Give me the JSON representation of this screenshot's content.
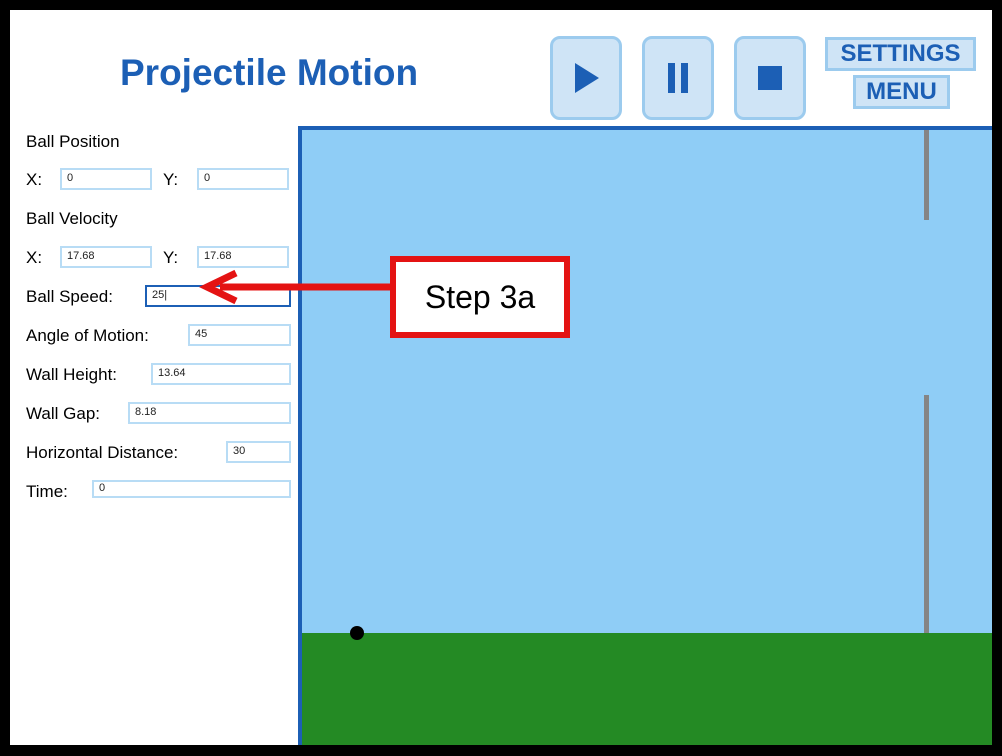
{
  "title": "Projectile Motion",
  "controls": {
    "play": "play-icon",
    "pause": "pause-icon",
    "stop": "stop-icon",
    "settings_label": "SETTINGS",
    "menu_label": "MENU"
  },
  "panel": {
    "ball_position_label": "Ball Position",
    "pos_x_label": "X:",
    "pos_x_value": "0",
    "pos_y_label": "Y:",
    "pos_y_value": "0",
    "ball_velocity_label": "Ball Velocity",
    "vel_x_label": "X:",
    "vel_x_value": "17.68",
    "vel_y_label": "Y:",
    "vel_y_value": "17.68",
    "speed_label": "Ball Speed:",
    "speed_value": "25|",
    "angle_label": "Angle of Motion:",
    "angle_value": "45",
    "wall_height_label": "Wall Height:",
    "wall_height_value": "13.64",
    "wall_gap_label": "Wall Gap:",
    "wall_gap_value": "8.18",
    "horiz_dist_label": "Horizontal Distance:",
    "horiz_dist_value": "30",
    "time_label": "Time:",
    "time_value": "0"
  },
  "callout": {
    "text": "Step 3a"
  },
  "colors": {
    "accent": "#1c5fb5",
    "sky": "#8fcdf6",
    "ground": "#248a24",
    "wall": "#858585",
    "callout": "#e41313"
  }
}
